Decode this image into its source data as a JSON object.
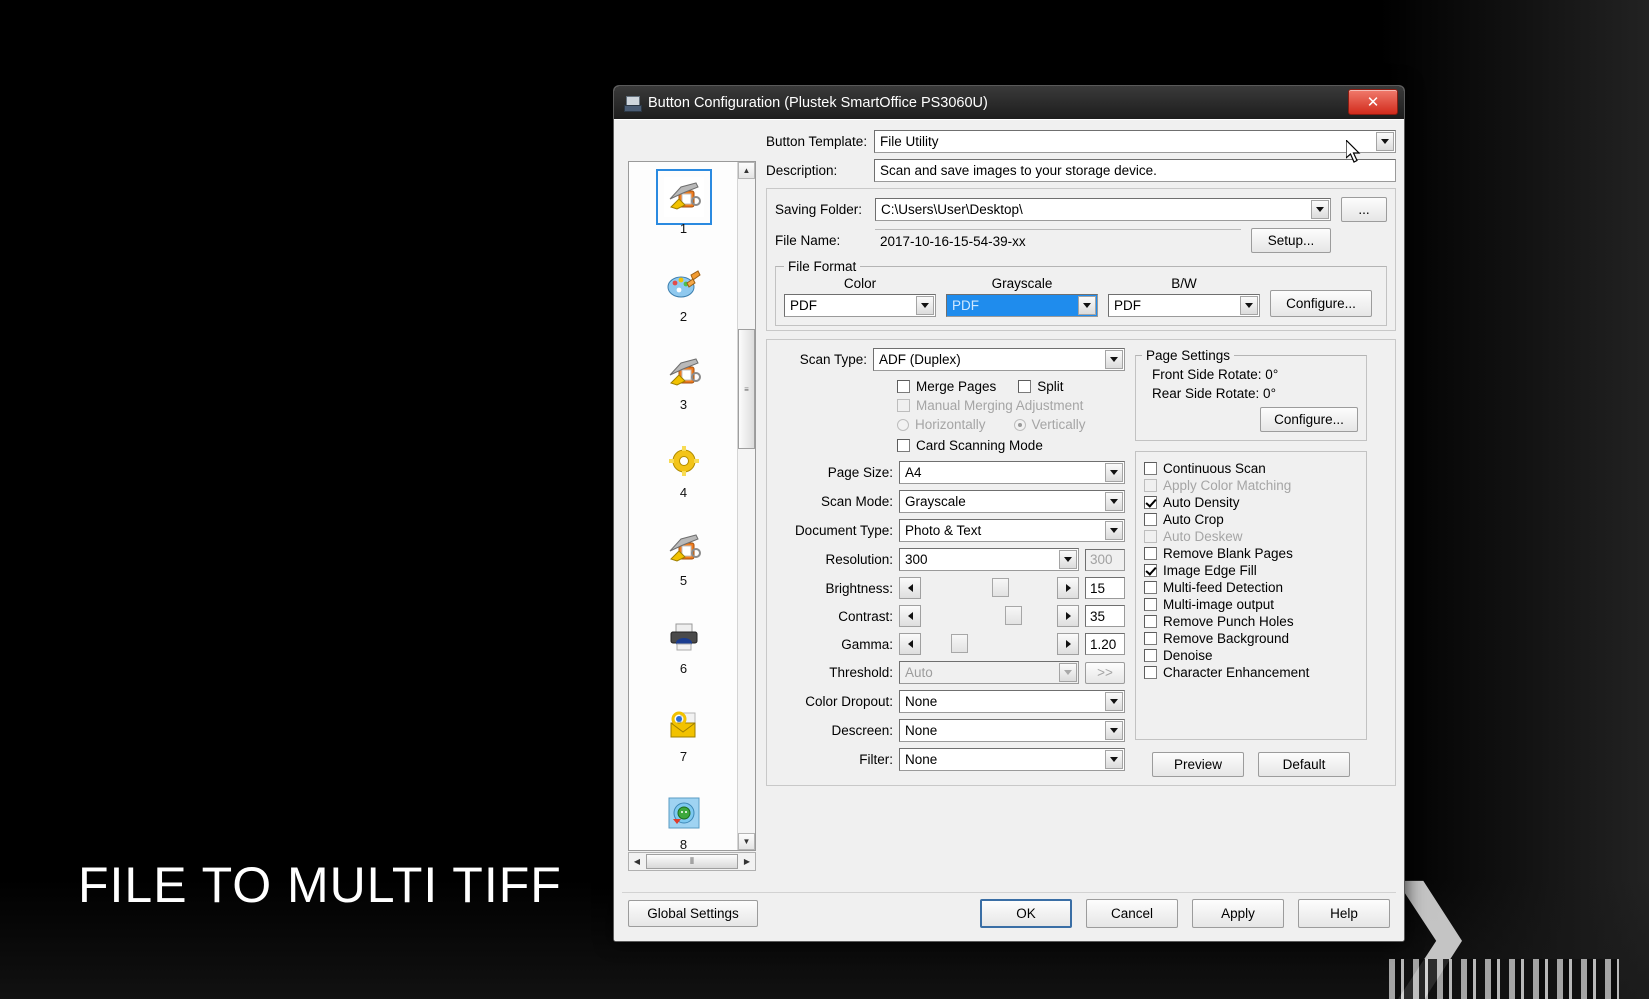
{
  "overlay_text": "FILE TO MULTI TIFF",
  "window": {
    "title": "Button Configuration (Plustek SmartOffice PS3060U)",
    "close_label": "✕",
    "icon": "scanner-icon"
  },
  "sidebar": {
    "items": [
      {
        "num": "1",
        "icon": "scanner-file-icon",
        "glyph": "🖨",
        "selected": true
      },
      {
        "num": "2",
        "icon": "palette-icon",
        "glyph": "🎨",
        "selected": false
      },
      {
        "num": "3",
        "icon": "scanner-file-icon",
        "glyph": "🖨",
        "selected": false
      },
      {
        "num": "4",
        "icon": "ocr-gear-icon",
        "glyph": "⚙",
        "selected": false
      },
      {
        "num": "5",
        "icon": "scanner-file-icon",
        "glyph": "🖨",
        "selected": false
      },
      {
        "num": "6",
        "icon": "printer-icon",
        "glyph": "🖶",
        "selected": false
      },
      {
        "num": "7",
        "icon": "email-icon",
        "glyph": "✉",
        "selected": false
      },
      {
        "num": "8",
        "icon": "globe-upload-icon",
        "glyph": "🌐",
        "selected": false
      }
    ],
    "scroll_up": "▲",
    "scroll_down": "▼",
    "scroll_left": "◀",
    "scroll_right": "▶",
    "thumb_grip": "≡",
    "hthumb_grip": "⦀"
  },
  "header": {
    "button_template_label": "Button Template:",
    "button_template_value": "File Utility",
    "description_label": "Description:",
    "description_value": "Scan and save images to your storage device."
  },
  "saving": {
    "folder_label": "Saving Folder:",
    "folder_value": "C:\\Users\\User\\Desktop\\",
    "browse_label": "...",
    "filename_label": "File Name:",
    "filename_value": "2017-10-16-15-54-39-xx",
    "setup_label": "Setup..."
  },
  "file_format": {
    "legend": "File Format",
    "color_label": "Color",
    "color_value": "PDF",
    "grayscale_label": "Grayscale",
    "grayscale_value": "PDF",
    "grayscale_highlighted": true,
    "bw_label": "B/W",
    "bw_value": "PDF",
    "configure_label": "Configure...",
    "highlight_color": "#1f8ced"
  },
  "scan": {
    "scan_type_label": "Scan Type:",
    "scan_type_value": "ADF (Duplex)",
    "merge_pages": {
      "label": "Merge Pages",
      "checked": false,
      "disabled": false
    },
    "split": {
      "label": "Split",
      "checked": false,
      "disabled": false
    },
    "manual_merging": {
      "label": "Manual Merging Adjustment",
      "checked": false,
      "disabled": true
    },
    "horizontally": {
      "label": "Horizontally",
      "selected": false,
      "disabled": true
    },
    "vertically": {
      "label": "Vertically",
      "selected": true,
      "disabled": true
    },
    "card_scanning": {
      "label": "Card Scanning Mode",
      "checked": false,
      "disabled": false
    },
    "page_size_label": "Page Size:",
    "page_size_value": "A4",
    "scan_mode_label": "Scan Mode:",
    "scan_mode_value": "Grayscale",
    "document_type_label": "Document Type:",
    "document_type_value": "Photo & Text",
    "resolution_label": "Resolution:",
    "resolution_value": "300",
    "resolution_box": "300",
    "brightness_label": "Brightness:",
    "brightness_value": "15",
    "contrast_label": "Contrast:",
    "contrast_value": "35",
    "gamma_label": "Gamma:",
    "gamma_value": "1.20",
    "threshold_label": "Threshold:",
    "threshold_value": "Auto",
    "threshold_more": ">>",
    "color_dropout_label": "Color Dropout:",
    "color_dropout_value": "None",
    "descreen_label": "Descreen:",
    "descreen_value": "None",
    "filter_label": "Filter:",
    "filter_value": "None"
  },
  "page_settings": {
    "legend": "Page Settings",
    "front_rotate": "Front Side Rotate: 0°",
    "rear_rotate": "Rear Side Rotate: 0°",
    "configure_label": "Configure..."
  },
  "options": [
    {
      "label": "Continuous Scan",
      "checked": false,
      "disabled": false
    },
    {
      "label": "Apply Color Matching",
      "checked": false,
      "disabled": true
    },
    {
      "label": "Auto Density",
      "checked": true,
      "disabled": false
    },
    {
      "label": "Auto Crop",
      "checked": false,
      "disabled": false
    },
    {
      "label": "Auto Deskew",
      "checked": false,
      "disabled": true
    },
    {
      "label": "Remove Blank Pages",
      "checked": false,
      "disabled": false
    },
    {
      "label": "Image Edge Fill",
      "checked": true,
      "disabled": false
    },
    {
      "label": "Multi-feed Detection",
      "checked": false,
      "disabled": false
    },
    {
      "label": "Multi-image output",
      "checked": false,
      "disabled": false
    },
    {
      "label": "Remove Punch Holes",
      "checked": false,
      "disabled": false
    },
    {
      "label": "Remove Background",
      "checked": false,
      "disabled": false
    },
    {
      "label": "Denoise",
      "checked": false,
      "disabled": false
    },
    {
      "label": "Character Enhancement",
      "checked": false,
      "disabled": false
    }
  ],
  "action_buttons": {
    "preview": "Preview",
    "default": "Default"
  },
  "footer": {
    "global_settings": "Global Settings",
    "ok": "OK",
    "cancel": "Cancel",
    "apply": "Apply",
    "help": "Help"
  }
}
